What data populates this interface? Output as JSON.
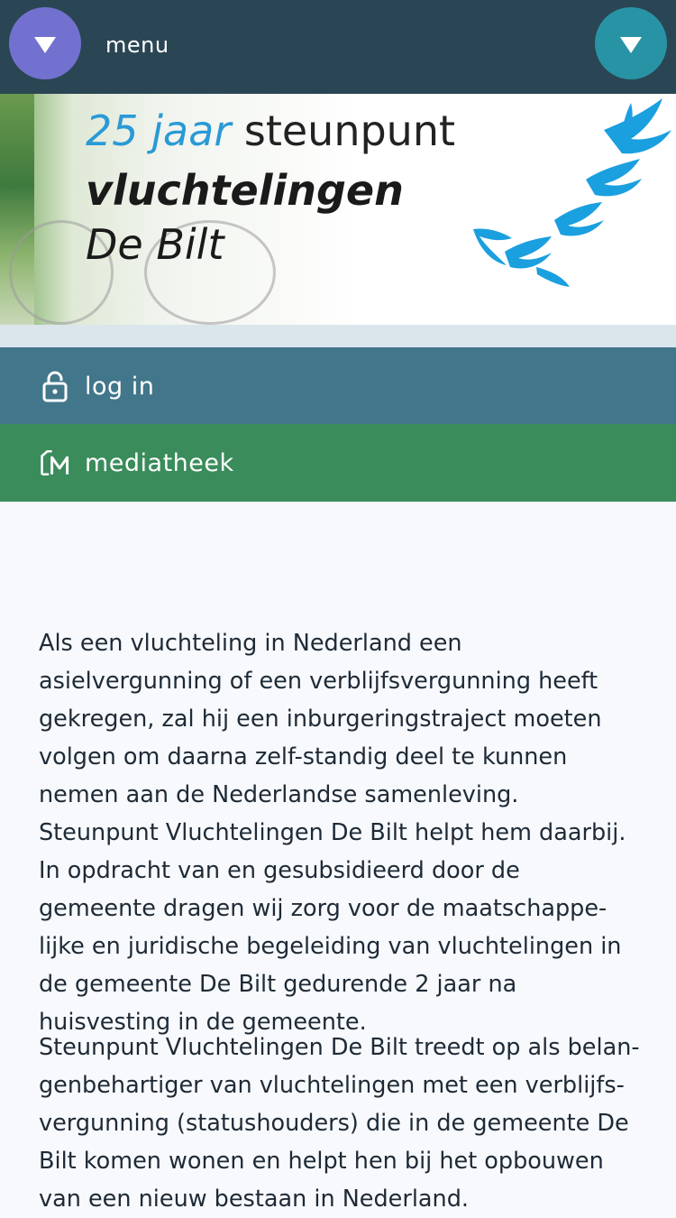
{
  "topbar": {
    "menu_label": "menu",
    "left_button_icon": "chevron-down-icon",
    "right_button_icon": "chevron-down-icon",
    "left_button_color": "#7371cf",
    "right_button_color": "#2993a6"
  },
  "banner": {
    "line1_number": "25 jaar",
    "line1_word": "steunpunt",
    "line2": "vluchtelingen",
    "line3": "De Bilt"
  },
  "nav": {
    "login_label": "log in",
    "login_icon": "lock-icon",
    "media_label": "mediatheek",
    "media_icon": "mediatheek-icon"
  },
  "main": {
    "paragraph1": "Als een vluchteling in Nederland een asielvergunning of een verblijfsvergunning heeft gekregen, zal hij een inburgeringstraject moeten volgen om daarna zelf-standig deel te kunnen nemen aan de Nederlandse samenleving. Steunpunt Vluchtelingen De Bilt helpt hem daarbij. In opdracht van en gesubsidieerd door de gemeente dragen wij zorg voor de maatschappe-lijke en juridische begeleiding van vluchtelingen in de gemeente De Bilt gedurende 2 jaar na huisvesting in de gemeente.",
    "paragraph2": "Steunpunt Vluchtelingen De Bilt treedt op als belan-genbehartiger van vluchtelingen met een verblijfs-vergunning (statushouders) die in de gemeente De Bilt komen wonen en helpt hen bij het opbouwen van een nieuw bestaan in Nederland."
  }
}
